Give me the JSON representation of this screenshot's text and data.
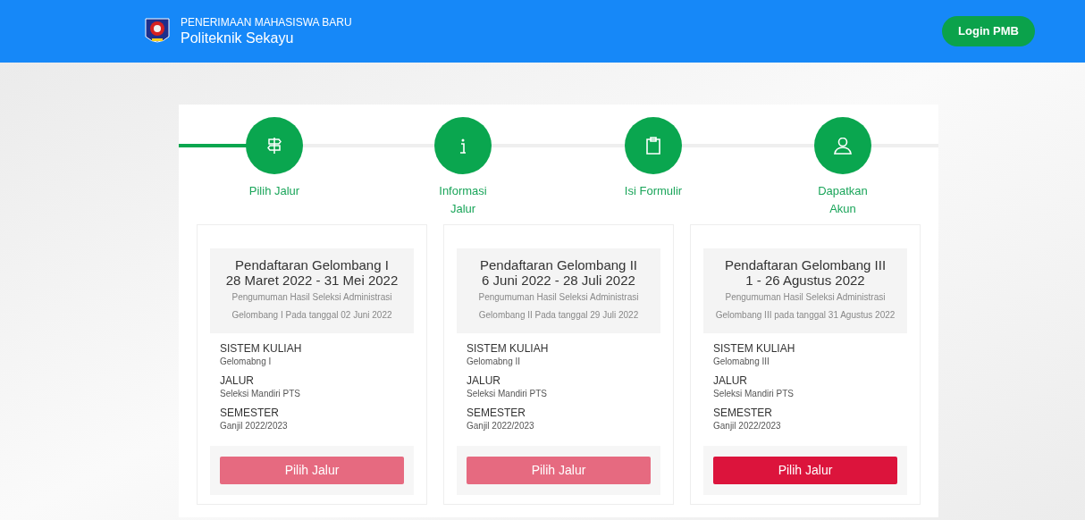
{
  "header": {
    "subtitle": "PENERIMAAN MAHASISWA BARU",
    "title": "Politeknik Sekayu",
    "login_button": "Login PMB"
  },
  "steps": [
    {
      "label": "Pilih Jalur",
      "kind": "signpost",
      "selected": true
    },
    {
      "label": "Informasi Jalur",
      "kind": "info",
      "selected": false
    },
    {
      "label": "Isi Formulir",
      "kind": "clipboard",
      "selected": false
    },
    {
      "label": "Dapatkan Akun",
      "kind": "user",
      "selected": false
    }
  ],
  "cards": [
    {
      "title": "Pendaftaran Gelombang I",
      "dates": "28 Maret 2022 - 31 Mei 2022",
      "note": "Pengumuman Hasil Seleksi Administrasi Gelombang I Pada tanggal 02 Juni 2022",
      "fields": [
        {
          "label": "SISTEM KULIAH",
          "value": "Gelomabng I"
        },
        {
          "label": "JALUR",
          "value": "Seleksi Mandiri PTS"
        },
        {
          "label": "SEMESTER",
          "value": "Ganjil 2022/2023"
        }
      ],
      "button": "Pilih Jalur",
      "disabled": true
    },
    {
      "title": "Pendaftaran Gelombang II",
      "dates": "6 Juni 2022 - 28 Juli 2022",
      "note": "Pengumuman Hasil Seleksi Administrasi Gelombang II Pada tanggal 29 Juli 2022",
      "fields": [
        {
          "label": "SISTEM KULIAH",
          "value": "Gelomabng II"
        },
        {
          "label": "JALUR",
          "value": "Seleksi Mandiri PTS"
        },
        {
          "label": "SEMESTER",
          "value": "Ganjil 2022/2023"
        }
      ],
      "button": "Pilih Jalur",
      "disabled": true
    },
    {
      "title": "Pendaftaran Gelombang III",
      "dates": "1 - 26 Agustus 2022",
      "note": "Pengumuman Hasil Seleksi Administrasi Gelombang III pada tanggal 31 Agustus 2022",
      "fields": [
        {
          "label": "SISTEM KULIAH",
          "value": "Gelomabng III"
        },
        {
          "label": "JALUR",
          "value": "Seleksi Mandiri PTS"
        },
        {
          "label": "SEMESTER",
          "value": "Ganjil 2022/2023"
        }
      ],
      "button": "Pilih Jalur",
      "disabled": false
    }
  ]
}
